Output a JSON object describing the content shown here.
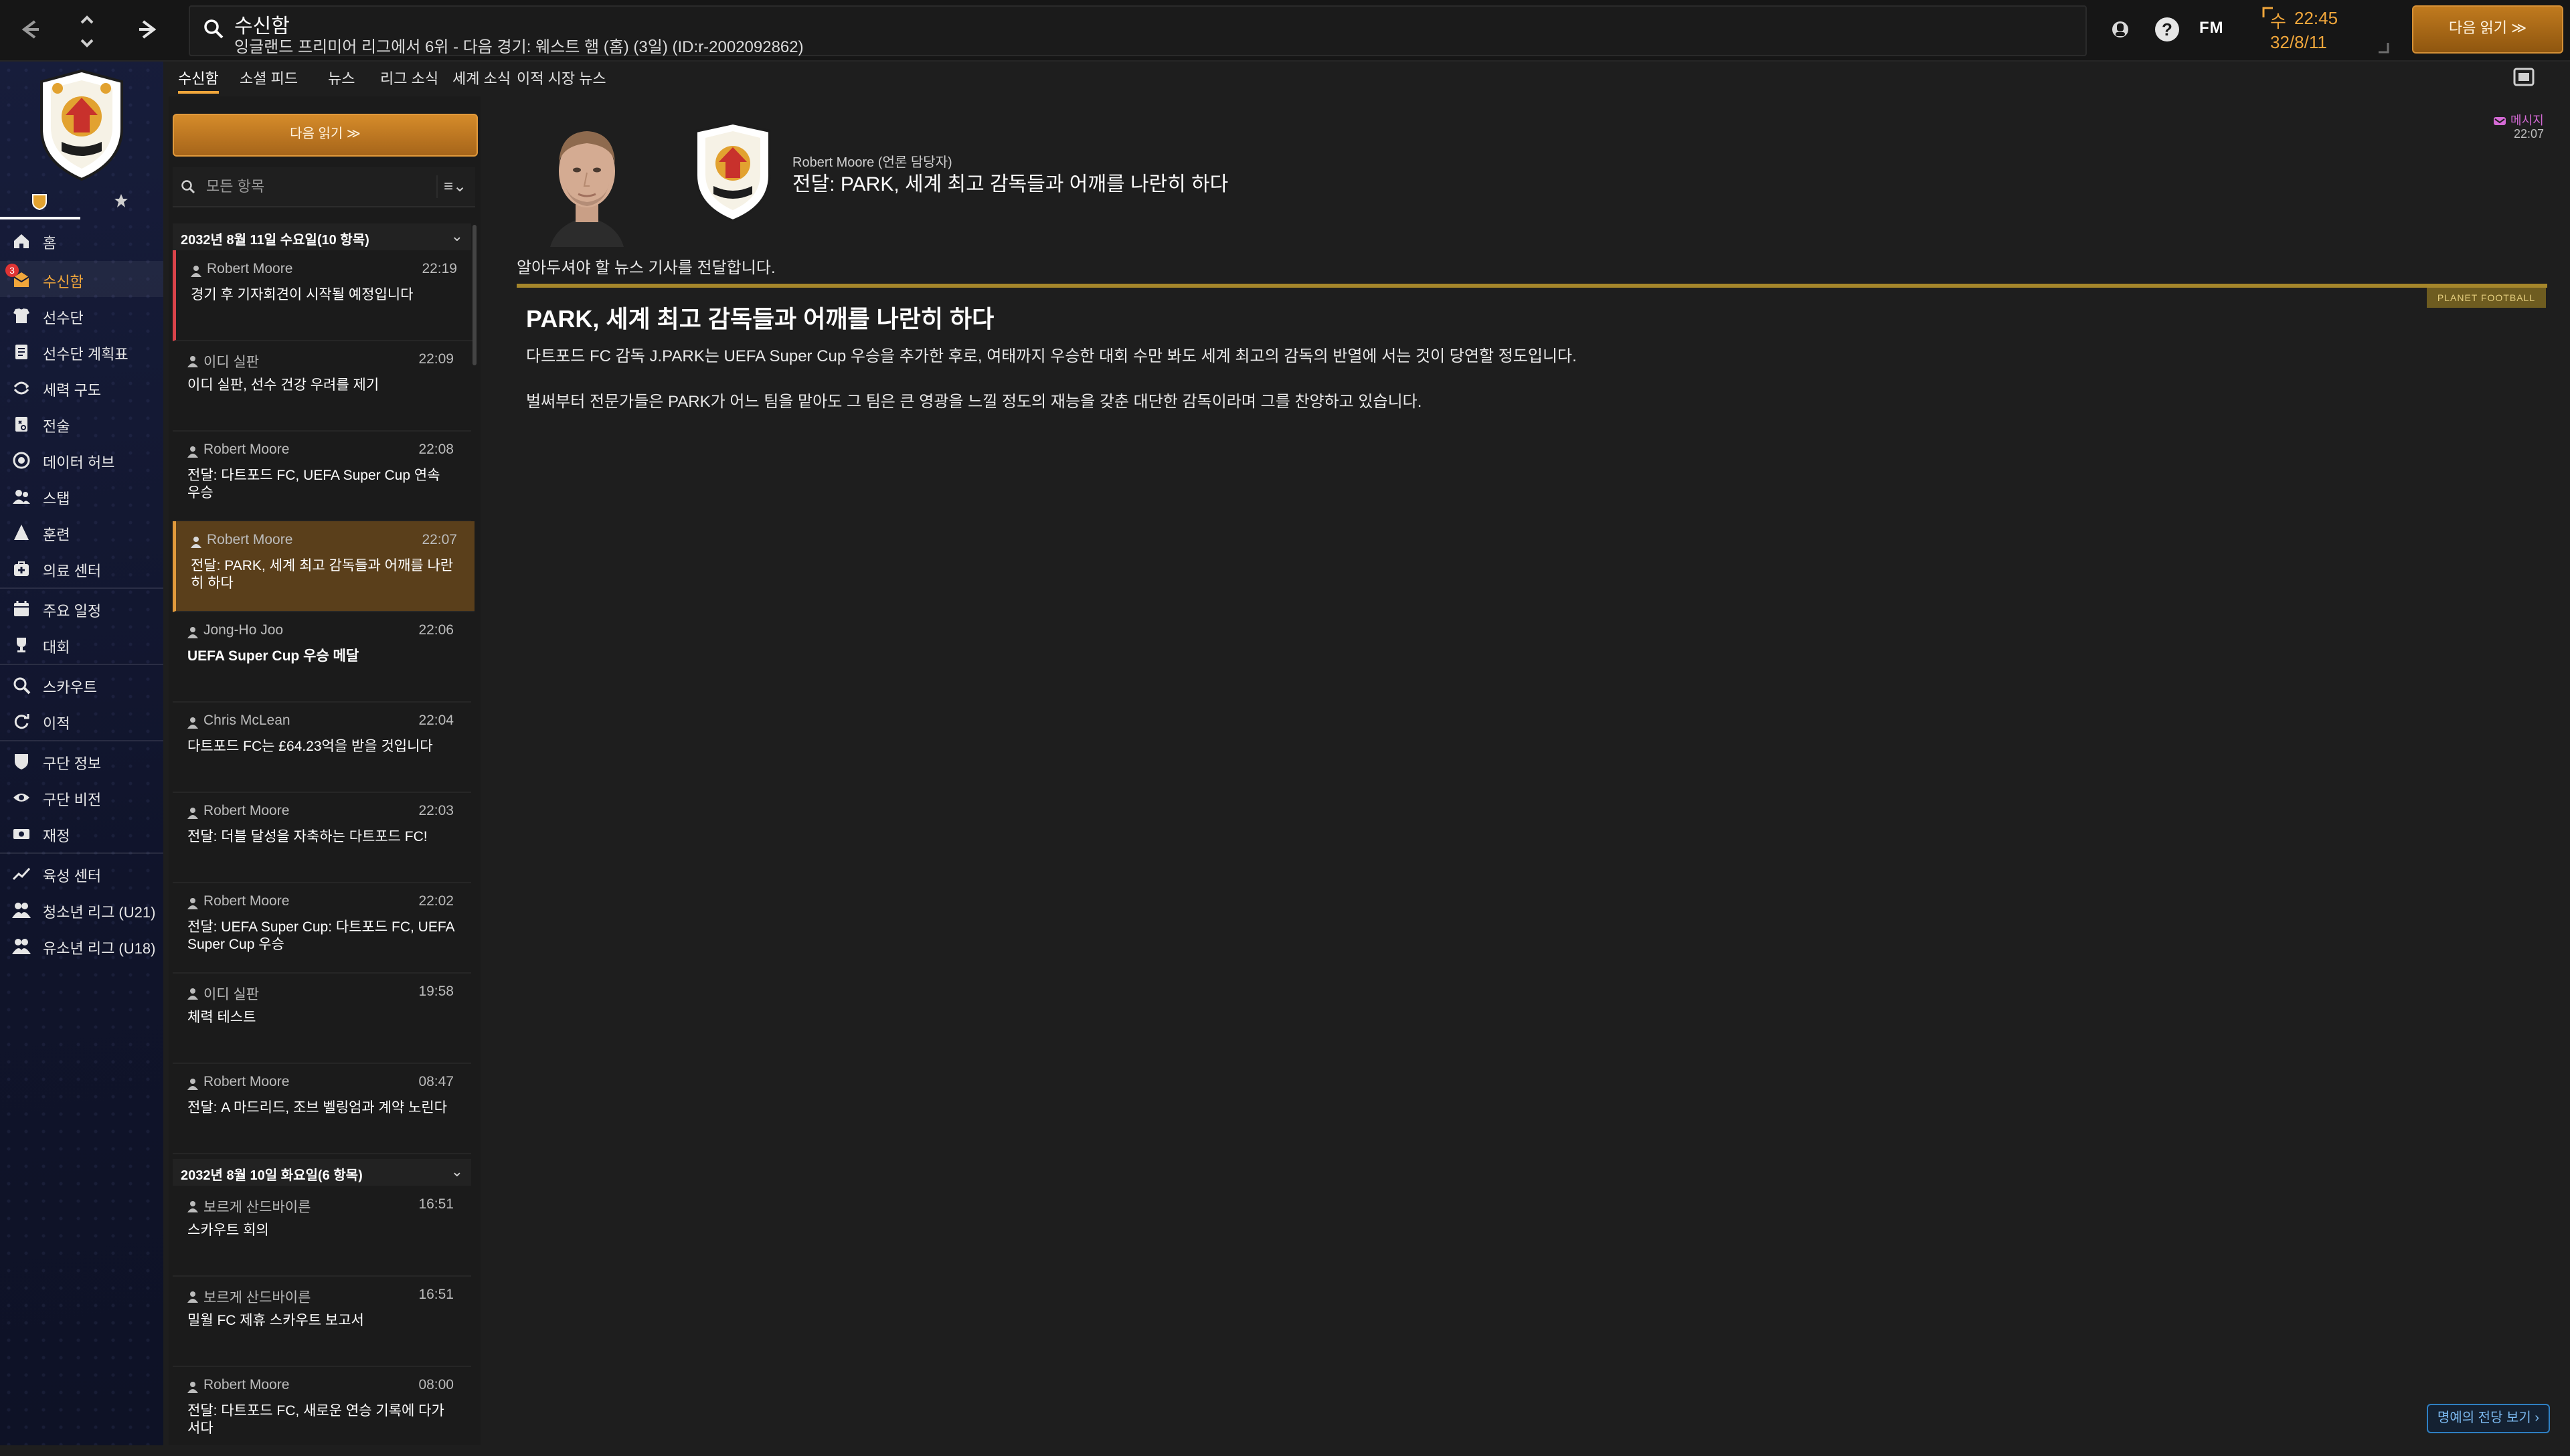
{
  "colors": {
    "accent": "#f0a63b",
    "unread": "#d9434a",
    "selected": "#5a3f1b",
    "sidebar": "#141935",
    "message_tag": "#d56ad6"
  },
  "header": {
    "title": "수신함",
    "subtitle": "잉글랜드 프리미어 리그에서 6위 - 다음 경기: 웨스트 햄 (홈) (3일) (ID:r-2002092862)",
    "help_icon": "?",
    "brand": "FM",
    "clock": {
      "day": "수",
      "time": "22:45",
      "date": "32/8/11"
    },
    "continue_label": "다음 읽기 ≫"
  },
  "sidebar": {
    "badge": "3",
    "items": [
      {
        "label": "홈",
        "icon": "home-icon"
      },
      {
        "label": "수신함",
        "icon": "inbox-icon"
      },
      {
        "label": "선수단",
        "icon": "squad-icon"
      },
      {
        "label": "선수단 계획표",
        "icon": "squad-planner-icon"
      },
      {
        "label": "세력 구도",
        "icon": "dynamics-icon"
      },
      {
        "label": "전술",
        "icon": "tactics-icon"
      },
      {
        "label": "데이터 허브",
        "icon": "data-hub-icon"
      },
      {
        "label": "스탭",
        "icon": "staff-icon"
      },
      {
        "label": "훈련",
        "icon": "training-icon"
      },
      {
        "label": "의료 센터",
        "icon": "medical-icon"
      },
      {
        "label": "주요 일정",
        "icon": "calendar-icon"
      },
      {
        "label": "대회",
        "icon": "trophy-icon"
      },
      {
        "label": "스카우트",
        "icon": "scouting-icon"
      },
      {
        "label": "이적",
        "icon": "transfers-icon"
      },
      {
        "label": "구단 정보",
        "icon": "club-info-icon"
      },
      {
        "label": "구단 비전",
        "icon": "club-vision-icon"
      },
      {
        "label": "재정",
        "icon": "finances-icon"
      },
      {
        "label": "육성 센터",
        "icon": "development-icon"
      },
      {
        "label": "청소년 리그 (U21)",
        "icon": "u21-icon"
      },
      {
        "label": "유소년 리그 (U18)",
        "icon": "u18-icon"
      }
    ]
  },
  "tabs": [
    "수신함",
    "소셜 피드",
    "뉴스",
    "리그 소식",
    "세계 소식",
    "이적 시장 뉴스"
  ],
  "inbox": {
    "read_next": "다음 읽기 ≫",
    "filter_placeholder": "모든 항목",
    "filter_menu": "≡⌄",
    "groups": [
      {
        "title": "2032년 8월 11일 수요일(10 항목)",
        "chevron": "⌄",
        "messages": [
          {
            "sender": "Robert Moore",
            "time": "22:19",
            "subject": "경기 후 기자회견이 시작될 예정입니다"
          },
          {
            "sender": "이디 실판",
            "time": "22:09",
            "subject": "이디 실판, 선수 건강 우려를 제기"
          },
          {
            "sender": "Robert Moore",
            "time": "22:08",
            "subject": "전달: 다트포드 FC, UEFA Super Cup 연속 우승"
          },
          {
            "sender": "Robert Moore",
            "time": "22:07",
            "subject": "전달: PARK, 세계 최고 감독들과 어깨를 나란히 하다"
          },
          {
            "sender": "Jong-Ho Joo",
            "time": "22:06",
            "subject": "UEFA Super Cup 우승 메달"
          },
          {
            "sender": "Chris McLean",
            "time": "22:04",
            "subject": "다트포드 FC는 £64.23억을 받을 것입니다"
          },
          {
            "sender": "Robert Moore",
            "time": "22:03",
            "subject": "전달: 더블 달성을 자축하는 다트포드 FC!"
          },
          {
            "sender": "Robert Moore",
            "time": "22:02",
            "subject": "전달: UEFA Super Cup: 다트포드 FC, UEFA Super Cup 우승"
          },
          {
            "sender": "이디 실판",
            "time": "19:58",
            "subject": "체력 테스트"
          },
          {
            "sender": "Robert Moore",
            "time": "08:47",
            "subject": "전달: A 마드리드, 조브 벨링엄과 계약 노린다"
          }
        ]
      },
      {
        "title": "2032년 8월 10일 화요일(6 항목)",
        "chevron": "⌄",
        "messages": [
          {
            "sender": "보르게 산드바이른",
            "time": "16:51",
            "subject": "스카우트 회의"
          },
          {
            "sender": "보르게 산드바이른",
            "time": "16:51",
            "subject": "밀월 FC 제휴 스카우트 보고서"
          },
          {
            "sender": "Robert Moore",
            "time": "08:00",
            "subject": "전달: 다트포드 FC, 새로운 연승 기록에 다가서다"
          }
        ]
      }
    ]
  },
  "message": {
    "from": "Robert Moore (언론 담당자)",
    "subject": "전달: PARK, 세계 최고 감독들과 어깨를 나란히 하다",
    "tag": "메시지",
    "time": "22:07",
    "intro": "알아두셔야 할 뉴스 기사를 전달합니다.",
    "source": "PLANET FOOTBALL",
    "headline": "PARK, 세계 최고 감독들과 어깨를 나란히 하다",
    "paragraphs": [
      "다트포드 FC 감독 J.PARK는 UEFA Super Cup 우승을 추가한 후로, 여태까지 우승한 대회 수만 봐도 세계 최고의 감독의 반열에 서는 것이 당연할 정도입니다.",
      "벌써부터 전문가들은 PARK가 어느 팀을 맡아도 그 팀은 큰 영광을 느낄 정도의 재능을 갖춘 대단한 감독이라며 그를 찬양하고 있습니다."
    ],
    "hall_of_fame": "명예의 전당 보기 ›"
  }
}
